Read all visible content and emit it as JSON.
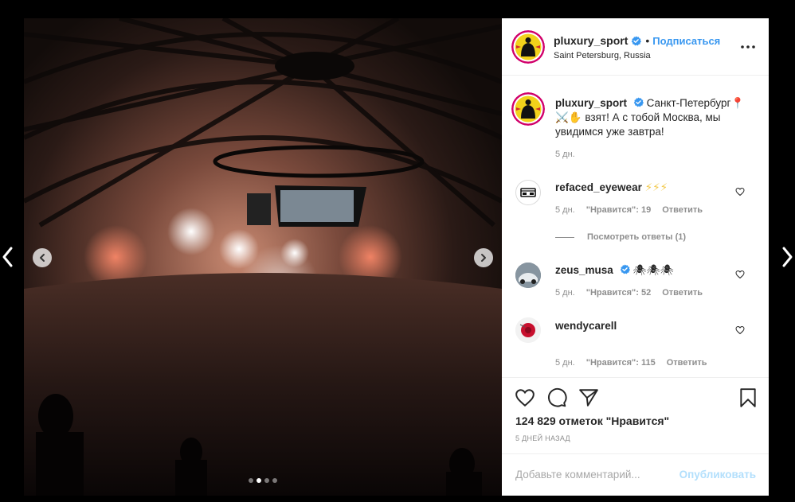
{
  "nav": {
    "prev_icon": "chevron-left-icon",
    "next_icon": "chevron-right-icon"
  },
  "carousel": {
    "dots_total": 4,
    "active_dot": 1
  },
  "post": {
    "username": "pluxury_sport",
    "follow_label": "Подписаться",
    "separator": "•",
    "location": "Saint Petersburg, Russia",
    "caption_text": "Санкт-Петербург📍⚔️✋ взят! А с тобой Москва, мы увидимся уже завтра!",
    "caption_time": "5 дн."
  },
  "comments": [
    {
      "username": "refaced_eyewear",
      "text": "⚡⚡⚡",
      "time": "5 дн.",
      "likes": "\"Нравится\": 19",
      "reply": "Ответить",
      "view_replies": "Посмотреть ответы (1)"
    },
    {
      "username": "zeus_musa",
      "text": "🕷🕷🕷",
      "time": "5 дн.",
      "likes": "\"Нравится\": 52",
      "reply": "Ответить"
    },
    {
      "username": "wendycarell",
      "text": "",
      "time": "5 дн.",
      "likes": "\"Нравится\": 115",
      "reply": "Ответить"
    }
  ],
  "actions": {
    "likes_text": "124 829 отметок \"Нравится\"",
    "time_ago": "5 ДНЕЙ НАЗАД"
  },
  "add_comment": {
    "placeholder": "Добавьте комментарий...",
    "publish_label": "Опубликовать"
  },
  "colors": {
    "link_blue": "#3897f0",
    "verified_blue": "#3897f0",
    "muted_text": "#8e8e8e",
    "publish_disabled": "#b2dffc"
  }
}
